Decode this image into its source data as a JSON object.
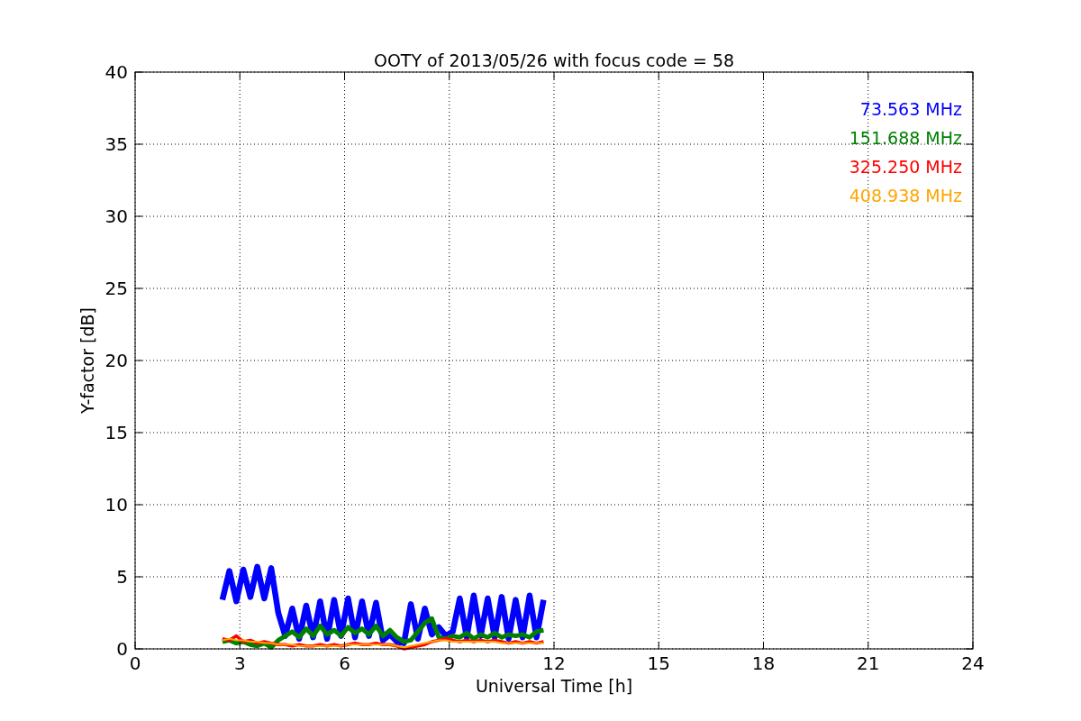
{
  "chart_data": {
    "type": "line",
    "title": "OOTY of 2013/05/26 with focus code = 58",
    "xlabel": "Universal Time [h]",
    "ylabel": "Y-factor [dB]",
    "x": [
      2.5,
      2.7,
      2.9,
      3.1,
      3.3,
      3.5,
      3.7,
      3.9,
      4.1,
      4.3,
      4.5,
      4.7,
      4.9,
      5.1,
      5.3,
      5.5,
      5.7,
      5.9,
      6.1,
      6.3,
      6.5,
      6.7,
      6.9,
      7.1,
      7.3,
      7.5,
      7.7,
      7.9,
      8.1,
      8.3,
      8.5,
      8.7,
      8.9,
      9.1,
      9.3,
      9.5,
      9.7,
      9.9,
      10.1,
      10.3,
      10.5,
      10.7,
      10.9,
      11.1,
      11.3,
      11.5,
      11.7
    ],
    "series": [
      {
        "name": "73.563 MHz",
        "color": "#0000ff",
        "values": [
          3.4,
          5.4,
          3.3,
          5.5,
          3.6,
          5.7,
          3.5,
          5.6,
          2.5,
          0.9,
          2.8,
          0.7,
          3.0,
          0.8,
          3.3,
          0.7,
          3.4,
          0.9,
          3.5,
          0.8,
          3.3,
          0.9,
          3.2,
          0.6,
          1.0,
          0.5,
          0.4,
          3.1,
          0.7,
          2.8,
          1.0,
          1.5,
          0.9,
          1.2,
          3.5,
          0.8,
          3.7,
          0.9,
          3.5,
          0.8,
          3.6,
          0.7,
          3.4,
          0.8,
          3.7,
          0.8,
          3.4
        ]
      },
      {
        "name": "151.688 MHz",
        "color": "#008000",
        "values": [
          0.5,
          0.6,
          0.4,
          0.5,
          0.3,
          0.2,
          0.4,
          0.1,
          0.6,
          0.9,
          1.2,
          0.8,
          1.4,
          0.9,
          1.6,
          1.0,
          1.3,
          0.9,
          1.5,
          1.1,
          1.4,
          1.0,
          1.6,
          0.9,
          1.3,
          0.8,
          0.5,
          0.6,
          1.2,
          1.8,
          2.1,
          0.8,
          0.7,
          0.9,
          0.8,
          1.1,
          0.7,
          1.0,
          0.8,
          1.1,
          0.8,
          1.0,
          0.9,
          1.0,
          0.8,
          1.2,
          1.3
        ]
      },
      {
        "name": "325.250 MHz",
        "color": "#ff0000",
        "values": [
          0.7,
          0.6,
          0.9,
          0.5,
          0.6,
          0.4,
          0.5,
          0.4,
          0.3,
          0.3,
          0.2,
          0.3,
          0.2,
          0.2,
          0.3,
          0.2,
          0.3,
          0.2,
          0.3,
          0.4,
          0.3,
          0.3,
          0.4,
          0.3,
          0.3,
          0.2,
          0.0,
          0.1,
          0.2,
          0.3,
          0.5,
          0.6,
          0.7,
          0.6,
          0.5,
          0.6,
          0.5,
          0.6,
          0.5,
          0.6,
          0.5,
          0.4,
          0.5,
          0.4,
          0.5,
          0.4,
          0.5
        ]
      },
      {
        "name": "408.938 MHz",
        "color": "#ffa500",
        "values": [
          0.6,
          0.7,
          0.6,
          0.6,
          0.5,
          0.5,
          0.4,
          0.4,
          0.3,
          0.3,
          0.3,
          0.2,
          0.2,
          0.2,
          0.2,
          0.2,
          0.2,
          0.2,
          0.3,
          0.3,
          0.3,
          0.3,
          0.3,
          0.3,
          0.3,
          0.2,
          0.1,
          0.2,
          0.3,
          0.4,
          0.5,
          0.6,
          0.6,
          0.5,
          0.5,
          0.5,
          0.5,
          0.5,
          0.5,
          0.5,
          0.4,
          0.4,
          0.4,
          0.4,
          0.4,
          0.4,
          0.4
        ]
      }
    ],
    "grid": true,
    "xlim": [
      0,
      24
    ],
    "ylim": [
      0,
      40
    ],
    "xticks": [
      0,
      3,
      6,
      9,
      12,
      15,
      18,
      21,
      24
    ],
    "yticks": [
      0,
      5,
      10,
      15,
      20,
      25,
      30,
      35,
      40
    ]
  }
}
